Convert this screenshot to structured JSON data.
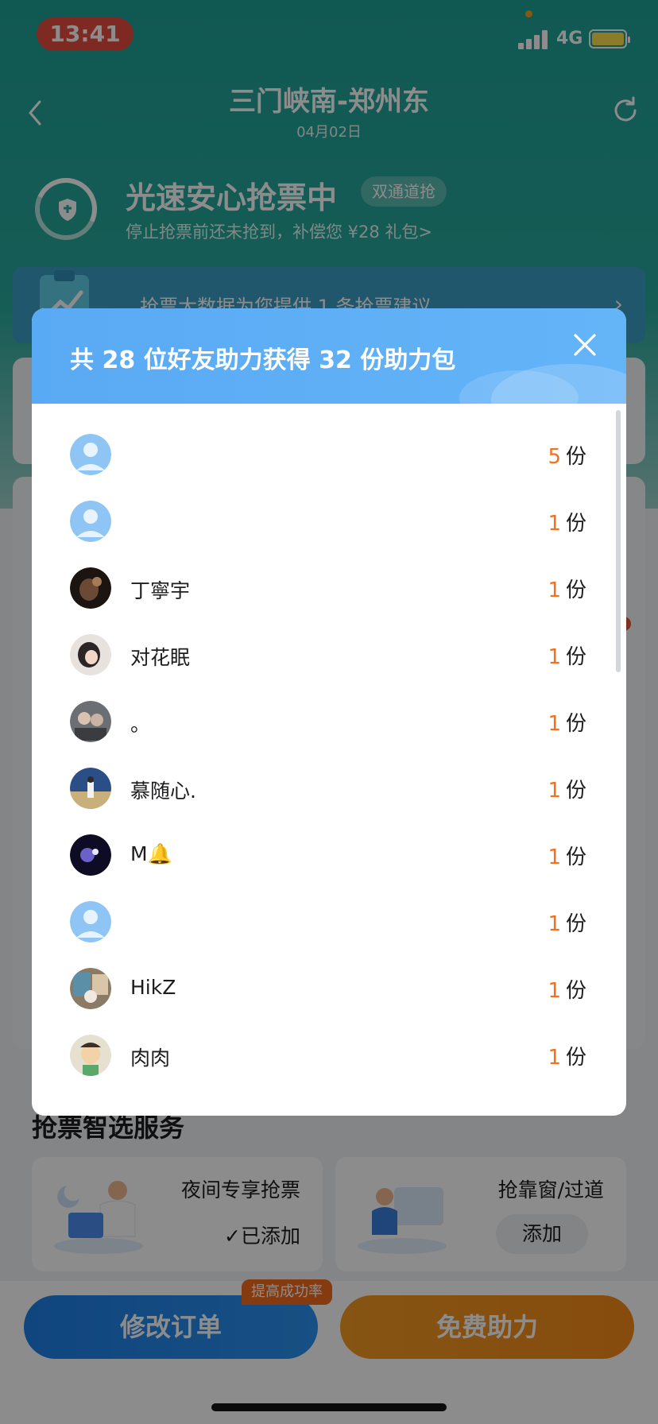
{
  "status_bar": {
    "time": "13:41",
    "network": "4G"
  },
  "nav": {
    "title": "三门峡南-郑州东",
    "date": "04月02日"
  },
  "speed": {
    "title": "光速安心抢票中",
    "badge": "双通道抢",
    "desc": "停止抢票前还未抢到，补偿您 ¥28 礼包>"
  },
  "banner": {
    "text": "抢票大数据为您提供 1 条抢票建议"
  },
  "services": {
    "title": "抢票智选服务",
    "items": [
      {
        "name": "夜间专享抢票",
        "status": "✓已添加"
      },
      {
        "name": "抢靠窗/过道",
        "action": "添加"
      }
    ]
  },
  "bottom": {
    "modify_label": "修改订单",
    "help_label": "免费助力",
    "boost_badge": "提高成功率"
  },
  "modal": {
    "title": "共 28 位好友助力获得 32 份助力包",
    "unit": "份",
    "friends": [
      {
        "name": "",
        "count": "5",
        "avatar": "default"
      },
      {
        "name": "",
        "count": "1",
        "avatar": "default"
      },
      {
        "name": "丁寧宇",
        "count": "1",
        "avatar": "photo-dark"
      },
      {
        "name": "对花眠",
        "count": "1",
        "avatar": "photo-girl"
      },
      {
        "name": "。",
        "count": "1",
        "avatar": "photo-people"
      },
      {
        "name": "慕随心.",
        "count": "1",
        "avatar": "photo-sky"
      },
      {
        "name": "M🔔",
        "count": "1",
        "avatar": "photo-night"
      },
      {
        "name": "",
        "count": "1",
        "avatar": "default"
      },
      {
        "name": "HikZ",
        "count": "1",
        "avatar": "photo-street"
      },
      {
        "name": "肉肉",
        "count": "1",
        "avatar": "cartoon"
      }
    ]
  },
  "colors": {
    "accent_orange": "#f2711c",
    "header_blue": "#59aaf4",
    "teal": "#1ea296"
  }
}
